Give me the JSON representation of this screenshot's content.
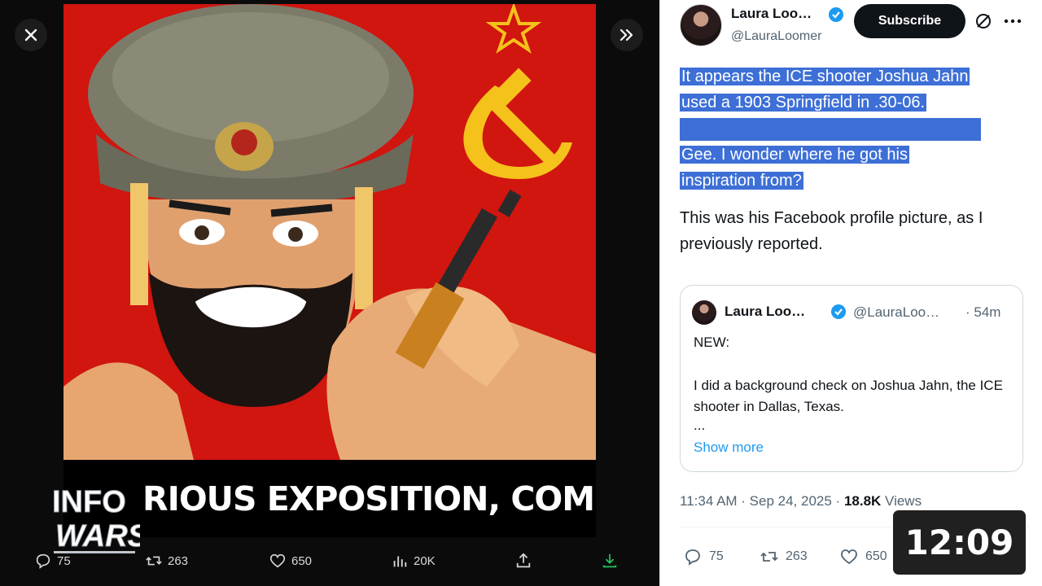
{
  "viewer": {
    "caption": "RIOUS EXPOSITION, COMRADE",
    "logo_line1": "INFO",
    "logo_line2": "WARS",
    "actions": {
      "replies": "75",
      "reposts": "263",
      "likes": "650",
      "views": "20K"
    }
  },
  "tweet": {
    "author_name": "Laura Loo…",
    "author_handle": "@LauraLoomer",
    "subscribe_label": "Subscribe",
    "highlight_line1": "It appears the ICE shooter Joshua Jahn",
    "highlight_line2": "used a 1903 Springfield in .30-06.",
    "highlight_line3": "Gee. I wonder where he got his",
    "highlight_line4": "inspiration from?",
    "plain_text": "This was his Facebook profile picture, as I previously reported.",
    "timestamp": "11:34 AM · Sep 24, 2025 · ",
    "view_count": "18.8K",
    "views_label": " Views",
    "actions": {
      "replies": "75",
      "reposts": "263",
      "likes": "650"
    }
  },
  "quote": {
    "name": "Laura Loo…",
    "handle": "@LauraLoo…",
    "time": "· 54m",
    "line1": "NEW:",
    "line2": "I did a background check on Joshua Jahn, the ICE shooter in Dallas, Texas.",
    "ellipsis": "...",
    "show_more": "Show more"
  },
  "video": {
    "duration": "12:09"
  },
  "colors": {
    "accent": "#1d9bf0",
    "selection": "#3d6fd6",
    "poster_red": "#d1150f"
  }
}
